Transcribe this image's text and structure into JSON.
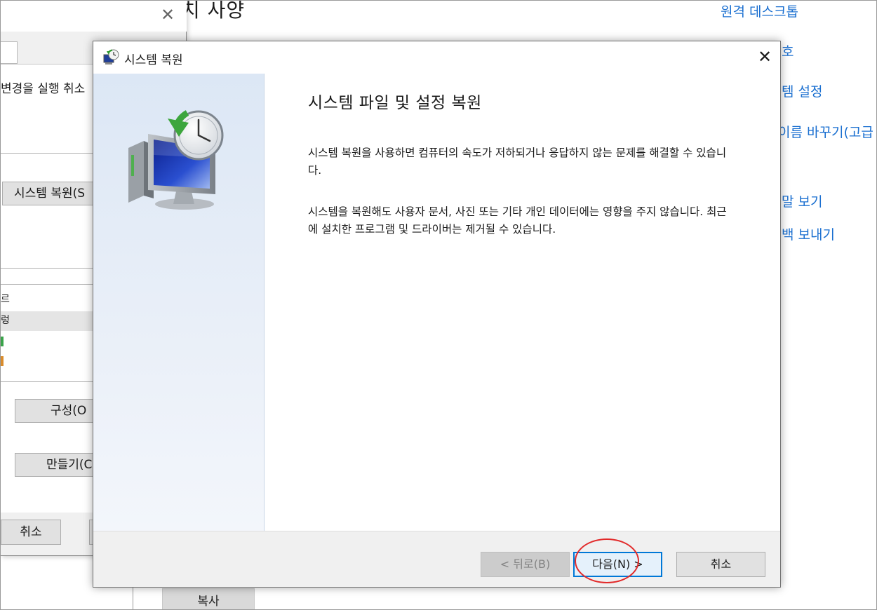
{
  "background_page": {
    "title_fragment": "치 사양",
    "links": [
      "원격 데스크톱",
      "호",
      "템 설정",
      "이름 바꾸기(고급",
      "말 보기",
      "백 보내기"
    ],
    "copy_button": "복사"
  },
  "properties_dialog": {
    "description": "변경을 실행 취소",
    "restore_button": "시스템 복원(S",
    "configure_button": "구성(O",
    "create_button": "만들기(C",
    "cancel_button": "취소",
    "list_rows": [
      "르",
      "렁",
      "",
      ""
    ],
    "colors": {
      "mark_green": "#3aa34a",
      "mark_orange": "#d98b2b"
    }
  },
  "restore_dialog": {
    "title": "시스템 복원",
    "heading": "시스템 파일 및 설정 복원",
    "paragraph1": "시스템 복원을 사용하면 컴퓨터의 속도가 저하되거나 응답하지 않는 문제를 해결할 수 있습니다.",
    "paragraph2": "시스템을 복원해도 사용자 문서, 사진 또는 기타 개인 데이터에는 영향을 주지 않습니다. 최근에 설치한 프로그램 및 드라이버는 제거될 수 있습니다.",
    "back_button": "< 뒤로(B)",
    "next_button": "다음(N) >",
    "cancel_button": "취소",
    "close_glyph": "✕",
    "icons": [
      "system-restore-icon",
      "monitor-clock-icon",
      "close-icon"
    ],
    "colors": {
      "accent": "#0078d7",
      "side_panel": "#dce7f5",
      "annotation": "#e22a2a"
    }
  }
}
